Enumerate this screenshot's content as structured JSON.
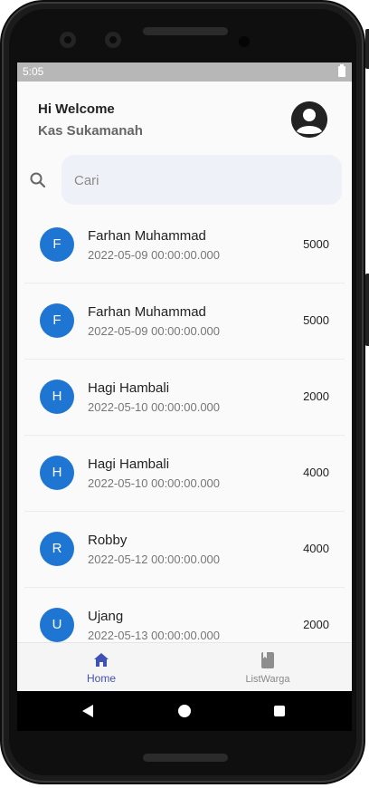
{
  "status_bar": {
    "time": "5:05"
  },
  "header": {
    "title": "Hi Welcome",
    "subtitle": "Kas Sukamanah"
  },
  "search": {
    "placeholder": "Cari"
  },
  "transactions": [
    {
      "initial": "F",
      "name": "Farhan Muhammad",
      "date": "2022-05-09 00:00:00.000",
      "amount": "5000"
    },
    {
      "initial": "F",
      "name": "Farhan Muhammad",
      "date": "2022-05-09 00:00:00.000",
      "amount": "5000"
    },
    {
      "initial": "H",
      "name": "Hagi Hambali",
      "date": "2022-05-10 00:00:00.000",
      "amount": "2000"
    },
    {
      "initial": "H",
      "name": "Hagi Hambali",
      "date": "2022-05-10 00:00:00.000",
      "amount": "4000"
    },
    {
      "initial": "R",
      "name": "Robby",
      "date": "2022-05-12 00:00:00.000",
      "amount": "4000"
    },
    {
      "initial": "U",
      "name": "Ujang",
      "date": "2022-05-13 00:00:00.000",
      "amount": "2000"
    }
  ],
  "bottom_nav": {
    "home_label": "Home",
    "list_label": "ListWarga"
  },
  "colors": {
    "accent": "#3f51b5",
    "avatar_circle": "#1f76d2"
  },
  "icons": {
    "profile": "account-circle-icon",
    "search": "search-icon",
    "home": "home-icon",
    "list": "book-icon"
  }
}
